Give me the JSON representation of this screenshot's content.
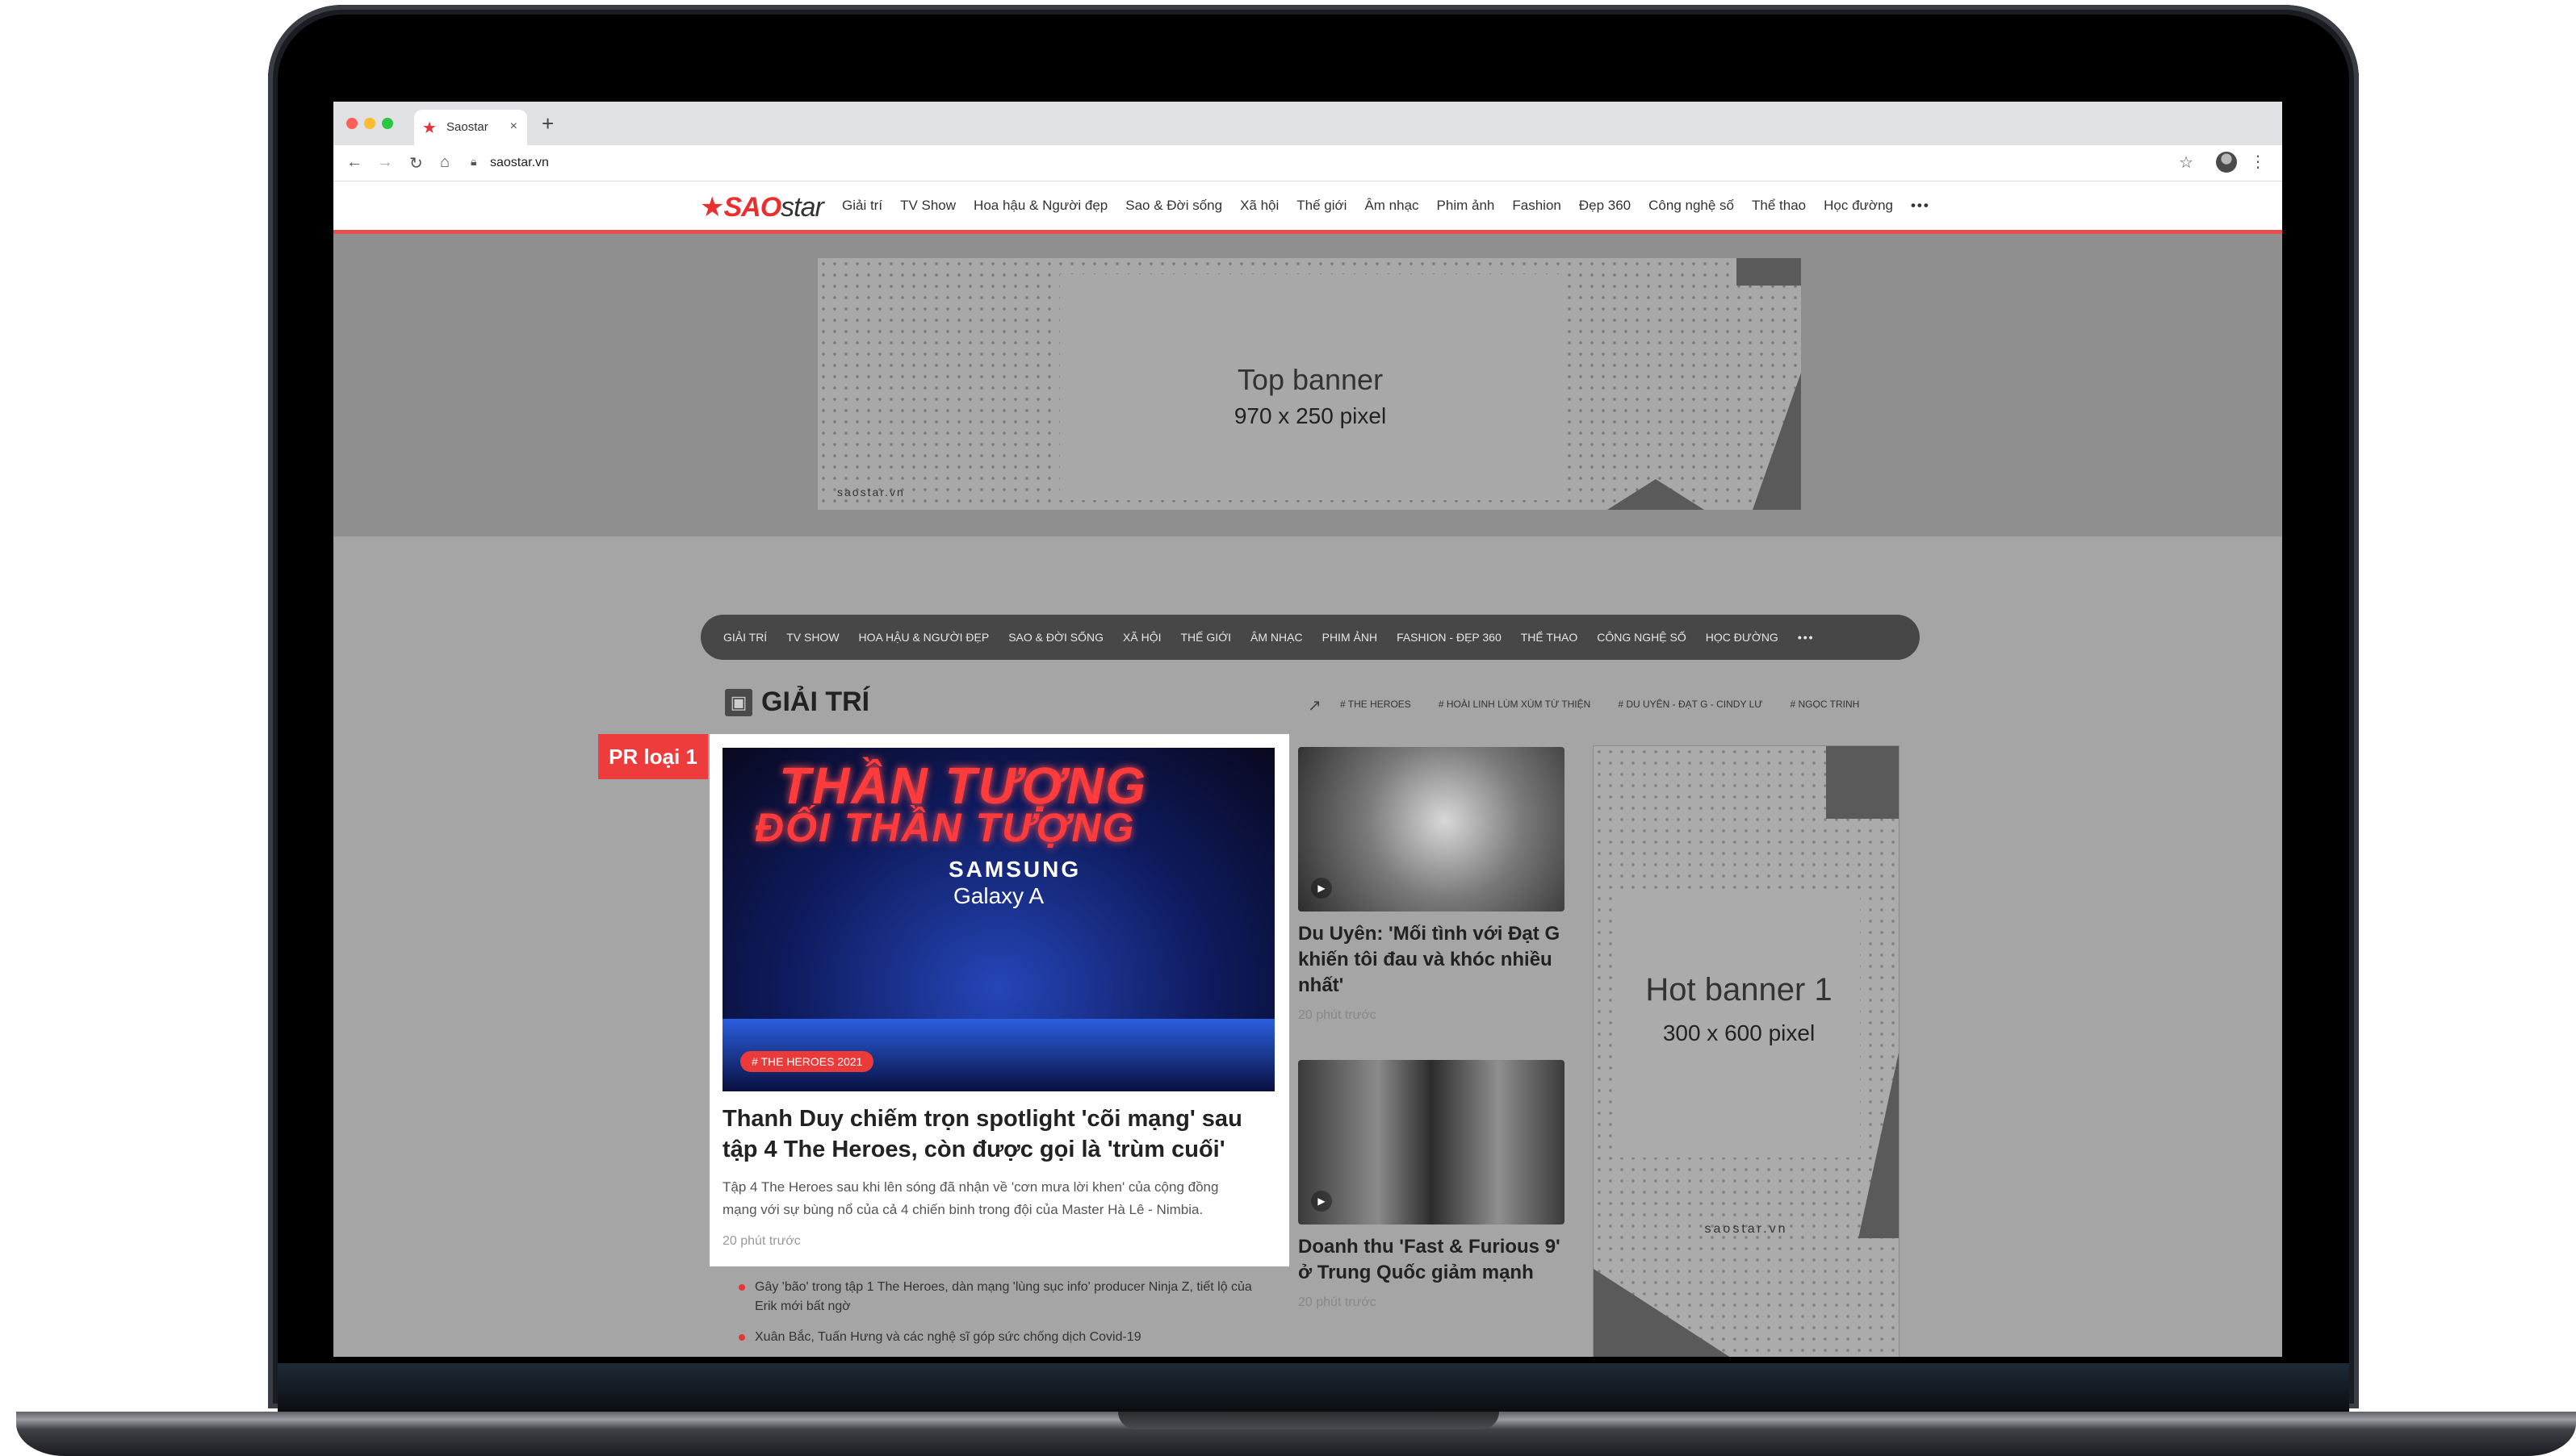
{
  "browser": {
    "tab_title": "Saostar",
    "url": "saostar.vn",
    "tab_close": "×",
    "new_tab": "+"
  },
  "site": {
    "logo_primary": "SAO",
    "logo_secondary": "star",
    "menu": [
      "Giải trí",
      "TV Show",
      "Hoa hậu & Người đẹp",
      "Sao & Đời sống",
      "Xã hội",
      "Thế giới",
      "Âm nhạc",
      "Phim ảnh",
      "Fashion",
      "Đẹp 360",
      "Công nghệ số",
      "Thể thao",
      "Học đường"
    ],
    "menu_more": "•••"
  },
  "top_banner": {
    "title": "Top banner",
    "size": "970 x 250 pixel",
    "watermark": "saostar.vn"
  },
  "category_bar": {
    "items": [
      "GIẢI TRÍ",
      "TV SHOW",
      "HOA HẬU & NGƯỜI ĐẸP",
      "SAO & ĐỜI SỐNG",
      "XÃ HỘI",
      "THẾ GIỚI",
      "ÂM NHẠC",
      "PHIM ẢNH",
      "FASHION - ĐẸP 360",
      "THỂ THAO",
      "CÔNG NGHỆ SỐ",
      "HỌC ĐƯỜNG"
    ],
    "more": "•••"
  },
  "section": {
    "title": "GIẢI TRÍ",
    "trending": [
      "# THE HEROES",
      "# HOÀI LINH LÙM XÙM TỪ THIỆN",
      "# DU UYÊN - ĐẠT G - CINDY LƯ",
      "# NGỌC TRINH"
    ]
  },
  "pr_label": "PR loại 1",
  "main_article": {
    "image_text": {
      "neon_line1": "THẦN TƯỢNG",
      "neon_line2": "ĐỐI THẦN TƯỢNG",
      "brand": "SAMSUNG",
      "model": "Galaxy A"
    },
    "tag": "# THE HEROES 2021",
    "title": "Thanh Duy chiếm trọn spotlight 'cõi mạng' sau tập 4 The Heroes, còn được gọi là 'trùm cuối'",
    "excerpt": "Tập 4 The Heroes sau khi lên sóng đã nhận về 'cơn mưa lời khen' của cộng đồng mạng với sự bùng nổ của cả 4 chiến binh trong đội của Master Hà Lê - Nimbia.",
    "time": "20 phút trước"
  },
  "related": [
    "Gây 'bão' trong tập 1 The Heroes, dàn mạng 'lùng sục info' producer Ninja Z, tiết lộ của Erik mới bất ngờ",
    "Xuân Bắc, Tuấn Hưng và các nghệ sĩ góp sức chống dịch Covid-19"
  ],
  "side_articles": [
    {
      "title": "Du Uyên: 'Mối tình với Đạt G khiến tôi đau và khóc nhiều nhất'",
      "time": "20 phút trước"
    },
    {
      "title": "Doanh thu 'Fast & Furious 9' ở Trung Quốc giảm mạnh",
      "time": "20 phút trước"
    }
  ],
  "hot_banner": {
    "title": "Hot banner 1",
    "size": "300 x 600 pixel",
    "watermark": "saostar.vn"
  },
  "colors": {
    "brand_red": "#ea2f2f",
    "header_border": "#ea4d4d",
    "category_bar": "#474747"
  },
  "icons": [
    "laptop-frame",
    "favicon-star-icon",
    "back-icon",
    "forward-icon",
    "reload-icon",
    "home-icon",
    "lock-icon",
    "bookmark-star-icon",
    "kebab-icon",
    "trending-icon",
    "section-icon",
    "play-icon"
  ]
}
